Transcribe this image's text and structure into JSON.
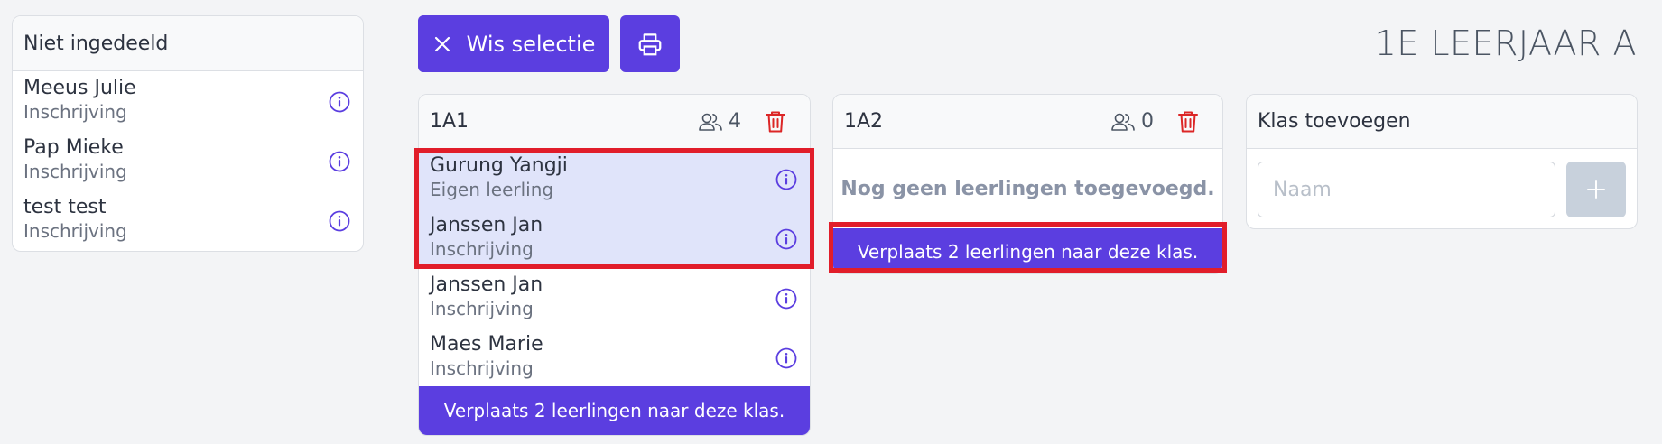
{
  "page": {
    "title": "1E LEERJAAR A"
  },
  "toolbar": {
    "clear_label": "Wis selectie"
  },
  "unassigned": {
    "title": "Niet ingedeeld",
    "students": [
      {
        "name": "Meeus Julie",
        "status": "Inschrijving"
      },
      {
        "name": "Pap Mieke",
        "status": "Inschrijving"
      },
      {
        "name": "test test",
        "status": "Inschrijving"
      }
    ]
  },
  "classes": [
    {
      "name": "1A1",
      "count": "4",
      "students": [
        {
          "name": "Gurung Yangji",
          "status": "Eigen leerling",
          "selected": true
        },
        {
          "name": "Janssen Jan",
          "status": "Inschrijving",
          "selected": true
        },
        {
          "name": "Janssen Jan",
          "status": "Inschrijving",
          "selected": false
        },
        {
          "name": "Maes Marie",
          "status": "Inschrijving",
          "selected": false
        }
      ],
      "move_label": "Verplaats 2 leerlingen naar deze klas."
    },
    {
      "name": "1A2",
      "count": "0",
      "empty_message": "Nog geen leerlingen toegevoegd.",
      "move_label": "Verplaats 2 leerlingen naar deze klas."
    }
  ],
  "add_class": {
    "title": "Klas toevoegen",
    "placeholder": "Naam"
  },
  "colors": {
    "accent": "#5b3ee0",
    "danger": "#dc2626",
    "highlight": "#e11d2a",
    "selected_bg": "#e0e4fa"
  },
  "icons": {
    "clear": "close-icon",
    "print": "printer-icon",
    "info": "info-icon",
    "count": "users-icon",
    "delete": "trash-icon",
    "add": "plus-icon"
  }
}
